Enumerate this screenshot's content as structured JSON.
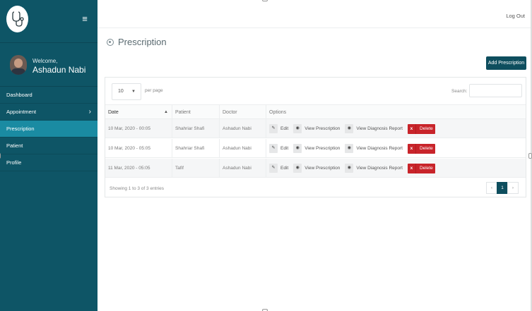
{
  "sidebar": {
    "logo_icon": "stethoscope-icon",
    "toggle_icon": "menu-icon",
    "welcome": "Welcome,",
    "username": "Ashadun Nabi",
    "items": [
      {
        "label": "Dashboard",
        "active": false
      },
      {
        "label": "Appointment",
        "active": false,
        "has_children": true
      },
      {
        "label": "Prescription",
        "active": true
      },
      {
        "label": "Patient",
        "active": false
      },
      {
        "label": "Profile",
        "active": false
      }
    ],
    "colors": {
      "background": "#0e5566",
      "active": "#1a8ba2"
    }
  },
  "header": {
    "logout": "Log Out"
  },
  "page": {
    "title": "Prescription",
    "add_button": "Add Prescription"
  },
  "table_controls": {
    "per_page_value": "10",
    "per_page_label": "per page",
    "search_label": "Search:",
    "search_value": ""
  },
  "table": {
    "columns": [
      "Date",
      "Patient",
      "Doctor",
      "Options"
    ],
    "rows": [
      {
        "date": "10 Mar, 2020 - 00:05",
        "patient": "Shahriar Shafi",
        "doctor": "Ashadun Nabi"
      },
      {
        "date": "10 Mar, 2020 - 05:05",
        "patient": "Shahriar Shafi",
        "doctor": "Ashadun Nabi"
      },
      {
        "date": "11 Mar, 2020 - 05:05",
        "patient": "Tafif",
        "doctor": "Ashadun Nabi"
      }
    ],
    "options": {
      "edit": "Edit",
      "view_prescription": "View Prescription",
      "view_diagnosis": "View Diagnosis Report",
      "delete": "Delete",
      "delete_icon": "x"
    }
  },
  "footer": {
    "showing": "Showing 1 to 3 of 3 entries",
    "prev": "‹",
    "page": "1",
    "next": "›"
  },
  "colors": {
    "primary": "#0e4e5e",
    "danger": "#c8242a"
  }
}
